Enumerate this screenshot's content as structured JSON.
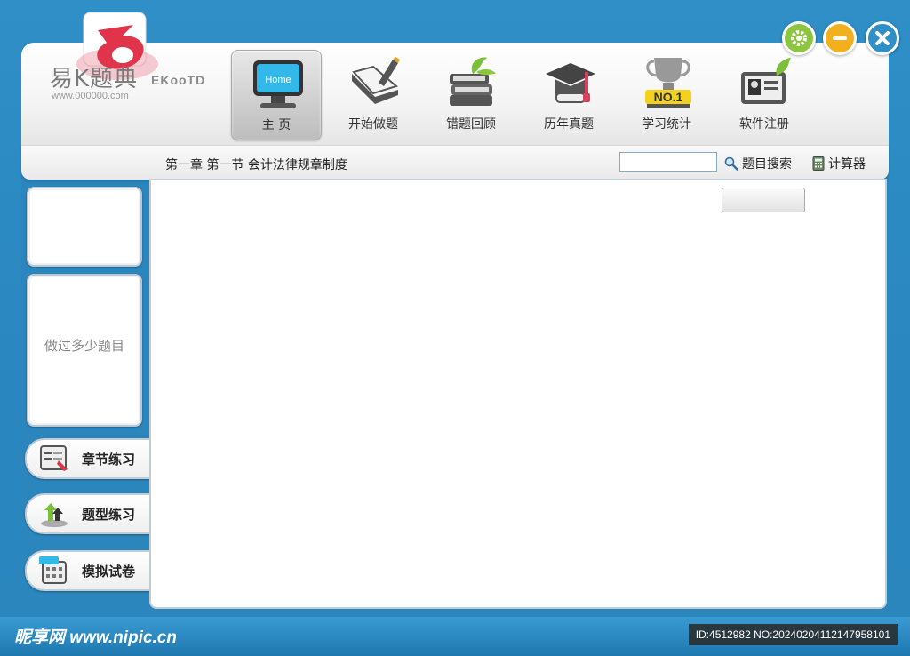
{
  "logo": {
    "name": "易K题典",
    "english": "EKooTD",
    "url": "www.000000.com"
  },
  "nav": [
    {
      "label": "主  页",
      "icon": "monitor-home-icon",
      "icon_text": "Home",
      "active": true
    },
    {
      "label": "开始做题",
      "icon": "pencil-book-icon"
    },
    {
      "label": "错题回顾",
      "icon": "books-leaf-icon"
    },
    {
      "label": "历年真题",
      "icon": "graduation-cap-icon"
    },
    {
      "label": "学习统计",
      "icon": "trophy-icon",
      "icon_text": "NO.1"
    },
    {
      "label": "软件注册",
      "icon": "id-card-icon"
    }
  ],
  "window_buttons": [
    "gear-icon",
    "minimize-icon",
    "close-icon"
  ],
  "subbar": {
    "breadcrumb": "第一章  第一节  会计法律规章制度",
    "search_input_value": "",
    "search_label": "题目搜索",
    "calculator_label": "计算器"
  },
  "sidebar": {
    "panel_top_text": "",
    "panel_stats_text": "做过多少题目",
    "buttons": [
      {
        "label": "章节练习",
        "icon": "chapter-practice-icon"
      },
      {
        "label": "题型练习",
        "icon": "question-type-icon"
      },
      {
        "label": "模拟试卷",
        "icon": "mock-exam-icon"
      }
    ]
  },
  "content": {
    "button_label": ""
  },
  "footer": {
    "brand": "昵享网 www.nipic.cn",
    "id_text": "ID:4512982 NO:20240204112147958101"
  },
  "colors": {
    "background": "#2b86bd",
    "gear": "#8cc63f",
    "minimize": "#f2b01e",
    "close": "#2f8fc6",
    "home_screen": "#33b8ea",
    "logo_red": "#e0344a"
  }
}
